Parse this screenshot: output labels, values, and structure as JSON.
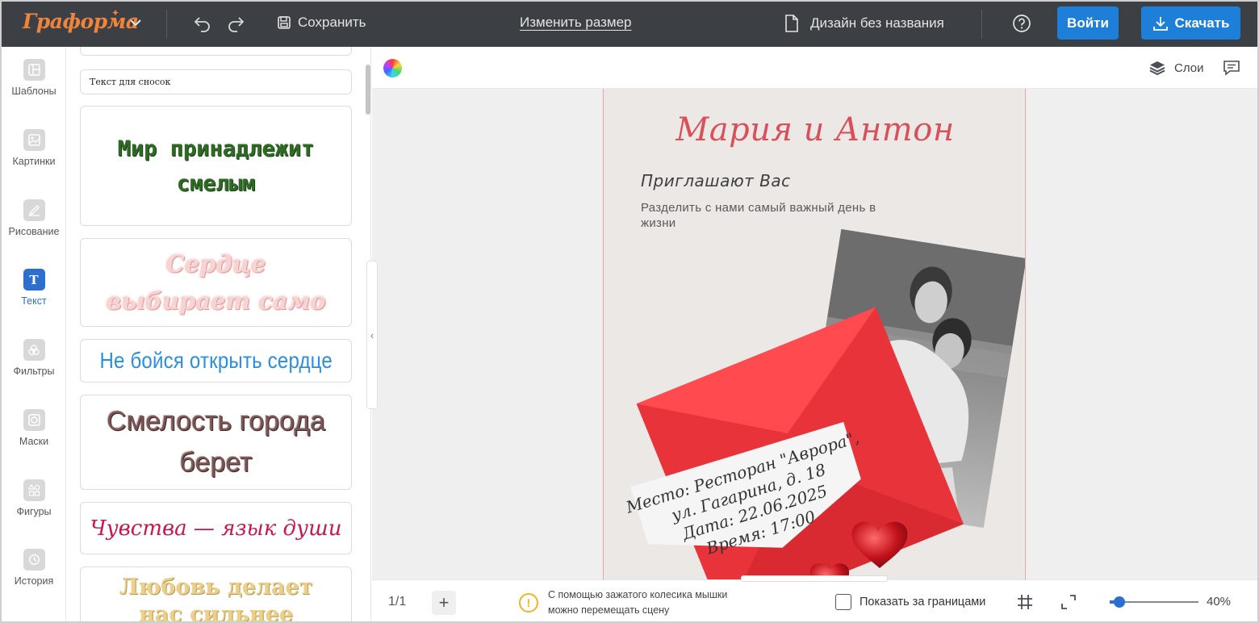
{
  "app": {
    "logo": "Граформа",
    "save_label": "Сохранить",
    "resize_label": "Изменить размер",
    "doc_name": "Дизайн без названия",
    "login_label": "Войти",
    "download_label": "Скачать"
  },
  "sidebar": {
    "items": [
      {
        "label": "Шаблоны",
        "icon": "templates-icon"
      },
      {
        "label": "Картинки",
        "icon": "images-icon"
      },
      {
        "label": "Рисование",
        "icon": "drawing-icon"
      },
      {
        "label": "Текст",
        "icon": "text-icon",
        "active": true
      },
      {
        "label": "Фильтры",
        "icon": "filters-icon"
      },
      {
        "label": "Маски",
        "icon": "masks-icon"
      },
      {
        "label": "Фигуры",
        "icon": "shapes-icon"
      },
      {
        "label": "История",
        "icon": "history-icon"
      }
    ]
  },
  "text_panel": {
    "caption_style": "Текст для сносок",
    "presets": [
      {
        "text": "Мир принадлежит смелым",
        "color": "#2f6b24"
      },
      {
        "text": "Сердце выбирает само",
        "color": "#f5c7c7"
      },
      {
        "text": "Не бойся открыть сердце",
        "color": "#2a8fe0"
      },
      {
        "text": "Смелость города берет",
        "color": "#7a5655"
      },
      {
        "text": "Чувства — язык души",
        "color": "#c8174e"
      },
      {
        "text": "Любовь делает нас сильнее",
        "color": "#e8c87a"
      }
    ]
  },
  "workspace": {
    "layers_label": "Слои"
  },
  "design": {
    "title": "Мария и Антон",
    "subtitle": "Приглашают Вас",
    "description": "Разделить с нами самый важный день в жизни",
    "note_lines": [
      "Место: Ресторан \"Аврора\",",
      "ул. Гагарина, д. 18",
      "Дата: 22.06.2025",
      "Время: 17:00"
    ],
    "accent_color": "#d8505a",
    "envelope_color": "#e8333a"
  },
  "bottom_bar": {
    "pager": "1/1",
    "hint_line1": "С помощью зажатого колесика мышки",
    "hint_line2": "можно перемещать сцену",
    "show_bounds_label": "Показать за границами",
    "zoom_label": "40%",
    "zoom_value": 0.11
  }
}
